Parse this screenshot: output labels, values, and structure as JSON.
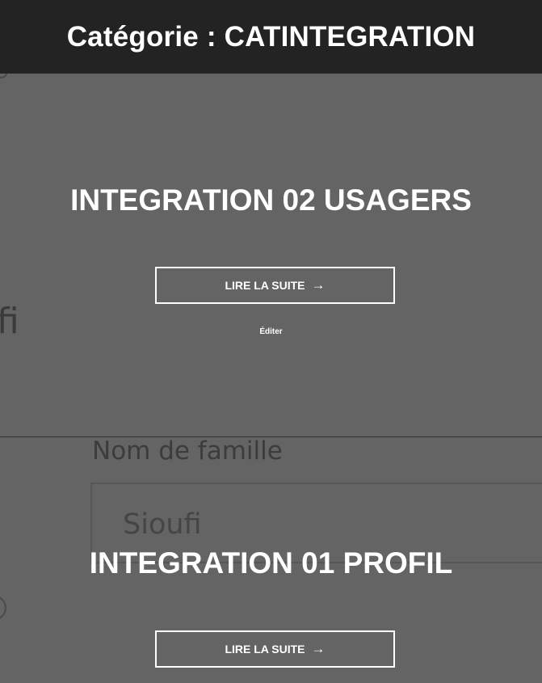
{
  "header": {
    "title": "Catégorie : CATINTEGRATION"
  },
  "posts": [
    {
      "title": "INTEGRATION 02 USAGERS",
      "read_more_label": "LIRE LA SUITE",
      "read_more_arrow": "→",
      "edit_label": "Éditer",
      "background": {
        "partial_text": "fi"
      }
    },
    {
      "title": "INTEGRATION 01 PROFIL",
      "read_more_label": "LIRE LA SUITE",
      "read_more_arrow": "→",
      "background": {
        "field_label": "Nom de famille",
        "field_value": "Sioufi"
      }
    }
  ],
  "colors": {
    "header_bg": "#232323",
    "overlay_bg": "#646464",
    "text": "#ffffff"
  }
}
